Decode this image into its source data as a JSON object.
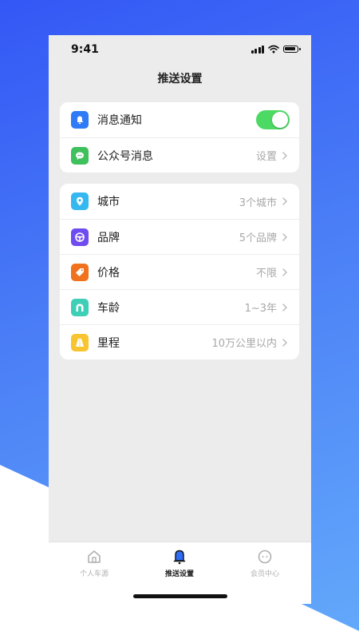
{
  "status_bar": {
    "time": "9:41"
  },
  "nav": {
    "title": "推送设置"
  },
  "notifications": {
    "rows": [
      {
        "label": "消息通知",
        "icon": "bell-icon",
        "icon_color": "#2f7bf6",
        "toggle_on": true
      },
      {
        "label": "公众号消息",
        "icon": "wechat-icon",
        "icon_color": "#3ec05c",
        "value": "设置"
      }
    ]
  },
  "filters": {
    "rows": [
      {
        "label": "城市",
        "icon": "location-pin-icon",
        "icon_color": "#35b8f0",
        "value": "3个城市"
      },
      {
        "label": "品牌",
        "icon": "steering-wheel-icon",
        "icon_color": "#6f4cf0",
        "value": "5个品牌"
      },
      {
        "label": "价格",
        "icon": "price-tag-icon",
        "icon_color": "#f0721e",
        "value": "不限"
      },
      {
        "label": "车龄",
        "icon": "arch-icon",
        "icon_color": "#3fcfb7",
        "value": "1~3年"
      },
      {
        "label": "里程",
        "icon": "road-icon",
        "icon_color": "#f8c531",
        "value": "10万公里以内"
      }
    ]
  },
  "tabbar": {
    "tabs": [
      {
        "label": "个人车源",
        "icon": "home-icon",
        "active": false
      },
      {
        "label": "推送设置",
        "icon": "bell-icon",
        "active": true
      },
      {
        "label": "会员中心",
        "icon": "chat-icon",
        "active": false
      }
    ]
  },
  "colors": {
    "accent": "#2f6df6",
    "toggle_on": "#4cd964",
    "background": "#ececec"
  }
}
